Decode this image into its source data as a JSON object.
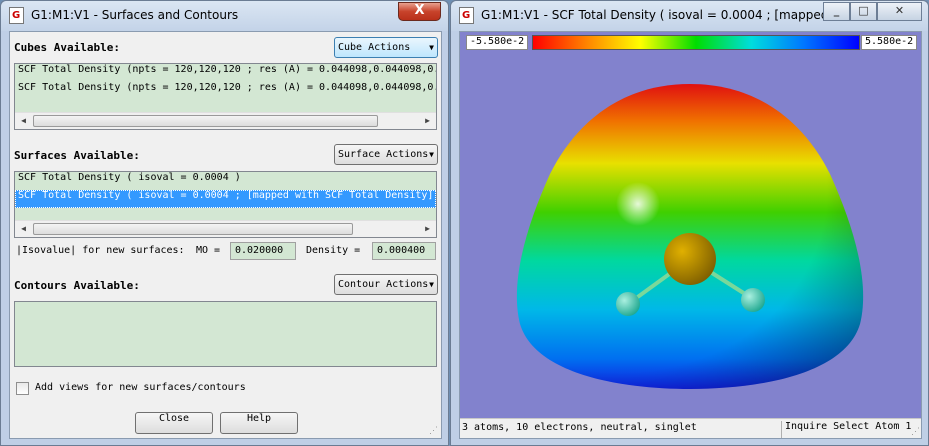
{
  "left_window": {
    "title": "G1:M1:V1 - Surfaces and Contours",
    "icon_glyph": "G",
    "close_glyph": "X",
    "cubes": {
      "label": "Cubes Available:",
      "action_button": "Cube Actions",
      "items": [
        "SCF Total Density (npts = 120,120,120 ; res (A) = 0.044098,0.044098,0.",
        "SCF Total Density (npts = 120,120,120 ; res (A) = 0.044098,0.044098,0."
      ]
    },
    "surfaces": {
      "label": "Surfaces Available:",
      "action_button": "Surface Actions",
      "items": [
        "SCF Total Density ( isoval = 0.0004 )",
        "SCF Total Density ( isoval = 0.0004 ; [mapped with SCF Total Density]"
      ],
      "selected_index": 1
    },
    "isovalue": {
      "label": "|Isovalue| for new surfaces:",
      "mo_label": "MO =",
      "mo_value": "0.020000",
      "density_label": "Density =",
      "density_value": "0.000400"
    },
    "contours": {
      "label": "Contours Available:",
      "action_button": "Contour Actions",
      "items": []
    },
    "add_views": {
      "label": "Add views for new surfaces/contours",
      "checked": false
    },
    "buttons": {
      "close": "Close",
      "help": "Help"
    }
  },
  "right_window": {
    "title": "G1:M1:V1 - SCF Total Density ( isoval = 0.0004 ; [mapped",
    "icon_glyph": "G",
    "color_scale": {
      "min_label": "-5.580e-2",
      "max_label": "5.580e-2",
      "colors": [
        "#ff0000",
        "#ffff00",
        "#00dd00",
        "#00dddd",
        "#0000ff"
      ]
    },
    "status": {
      "info": "3 atoms, 10 electrons, neutral, singlet",
      "mode": "Inquire Select Atom 1"
    },
    "background_color": "#8282cd"
  },
  "icons": {
    "window_icon": "gaussview-document-icon",
    "minimize": "minimize-icon",
    "maximize": "maximize-icon",
    "close": "close-icon",
    "dropdown": "chevron-down-icon"
  }
}
